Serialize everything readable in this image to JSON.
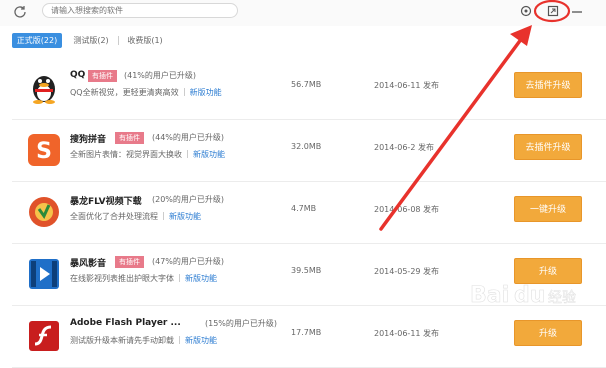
{
  "search": {
    "placeholder": "请输入想搜索的软件"
  },
  "tabs": [
    {
      "label": "正式版(22)",
      "active": true
    },
    {
      "label": "测试版(2)",
      "active": false
    },
    {
      "label": "收费版(1)",
      "active": false
    }
  ],
  "colors": {
    "accent": "#3a8fe0",
    "action": "#f2a93b",
    "tag": "#e87a8a",
    "annotation": "#e8322c"
  },
  "apps": [
    {
      "name": "QQ",
      "tag": "有插件",
      "users": "(41%的用户已升级)",
      "desc": "QQ全新视觉，更轻更清爽高效",
      "link": "新版功能",
      "size": "56.7MB",
      "date": "2014-06-11 发布",
      "action": "去插件升级",
      "icon": "qq-penguin-icon"
    },
    {
      "name": "搜狗拼音",
      "tag": "有插件",
      "users": "(44%的用户已升级)",
      "desc": "全新图片表情：视觉界面大换收",
      "link": "新版功能",
      "size": "32.0MB",
      "date": "2014-06-2 发布",
      "action": "去插件升级",
      "icon": "sogou-pinyin-icon"
    },
    {
      "name": "暴龙FLV视频下载",
      "tag": "",
      "users": "(20%的用户已升级)",
      "desc": "全面优化了合并处理流程",
      "link": "新版功能",
      "size": "4.7MB",
      "date": "2014-06-08 发布",
      "action": "一键升级",
      "icon": "flv-download-icon"
    },
    {
      "name": "暴风影音",
      "tag": "有插件",
      "users": "(47%的用户已升级)",
      "desc": "在线影视列表推出护眼大字体",
      "link": "新版功能",
      "size": "39.5MB",
      "date": "2014-05-29 发布",
      "action": "升级",
      "icon": "baofeng-player-icon"
    },
    {
      "name": "Adobe Flash Player ...",
      "tag": "",
      "users": "(15%的用户已升级)",
      "desc": "测试版升级本新请先手动卸载",
      "link": "新版功能",
      "size": "17.7MB",
      "date": "2014-06-11 发布",
      "action": "升级",
      "icon": "flash-player-icon"
    }
  ],
  "watermark": "Baidu 经验"
}
